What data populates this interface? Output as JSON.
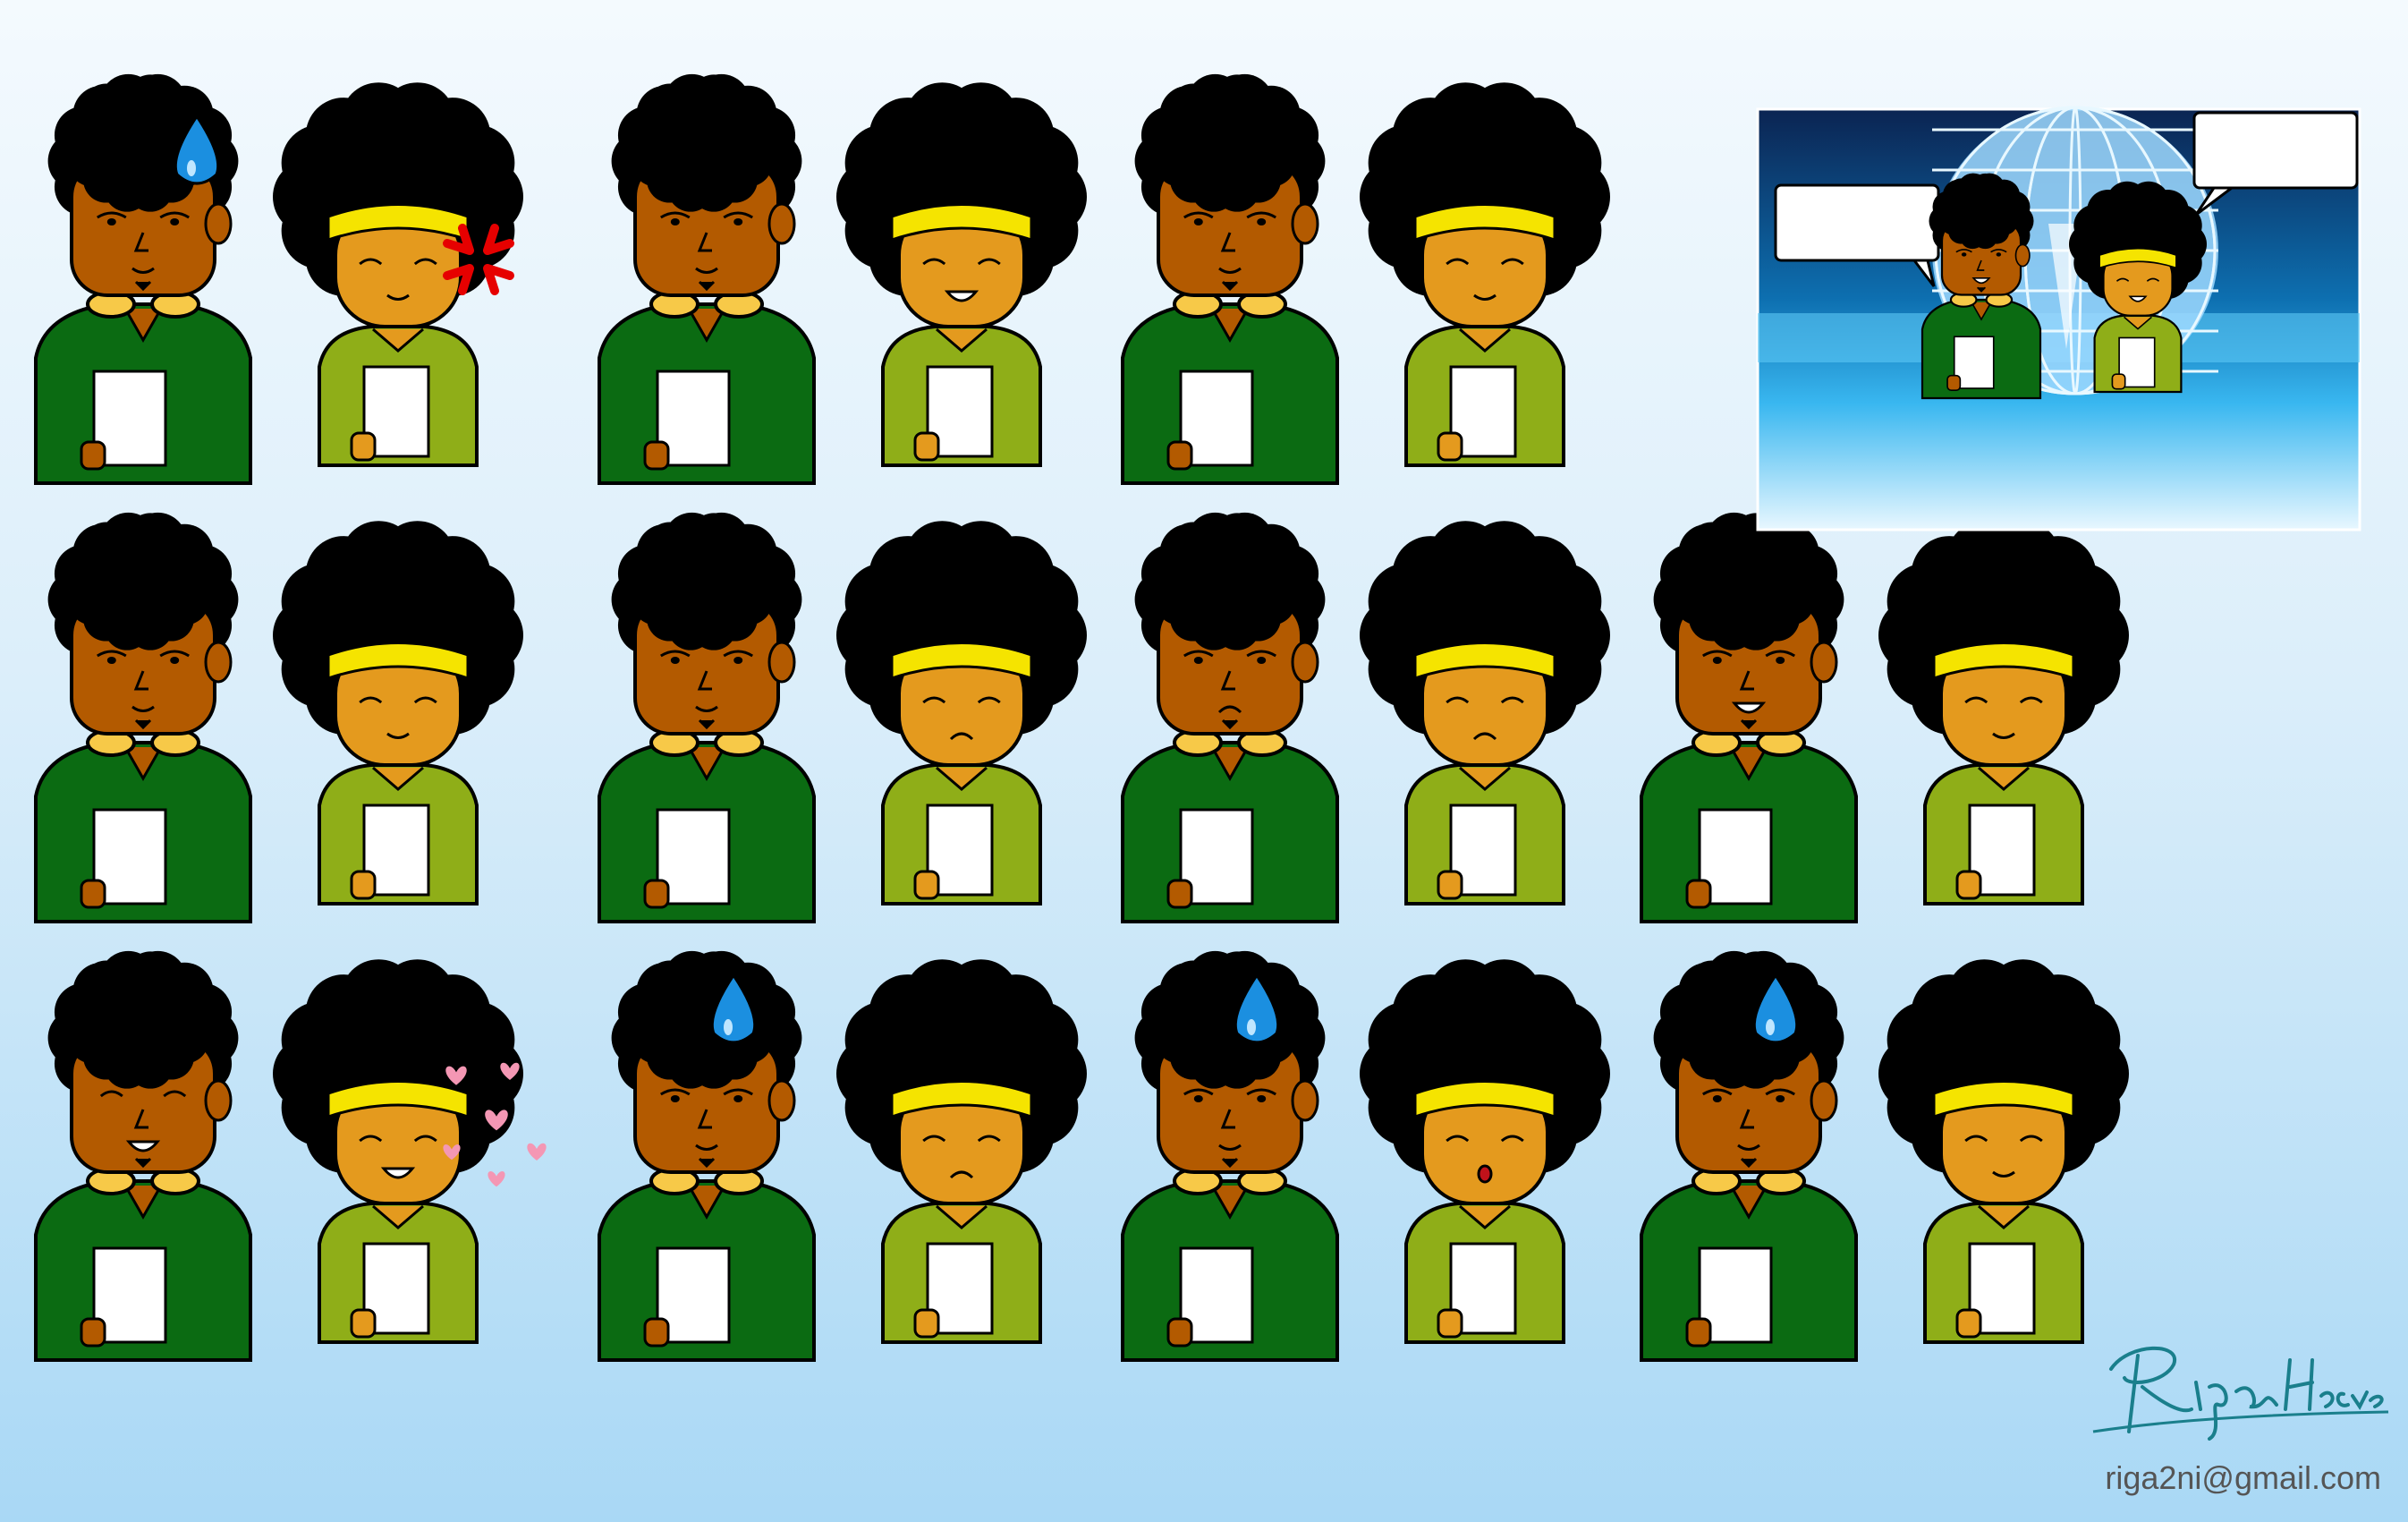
{
  "colors": {
    "skin_man": "#b35a00",
    "skin_girl": "#e49a1e",
    "shirt_man": "#0b6b12",
    "shirt_girl": "#8fae18",
    "hair": "#000000",
    "headband": "#f5e400",
    "goggles": "#f7c948",
    "paper": "#ffffff",
    "sweat": "#1b8fe0",
    "anger": "#e60000",
    "hearts": "#f497b4",
    "speech_bubble": "#ffffff",
    "signature": "#1a7f8c"
  },
  "sprite_rows": [
    [
      {
        "man_expression": "sweat-smirk",
        "girl_expression": "angry",
        "effect": "anger-mark"
      },
      {
        "man_expression": "neutral",
        "girl_expression": "grin",
        "effect": "none"
      },
      {
        "man_expression": "tired",
        "girl_expression": "worried-smile",
        "effect": "none"
      }
    ],
    [
      {
        "man_expression": "smirk",
        "girl_expression": "happy",
        "effect": "none"
      },
      {
        "man_expression": "bored",
        "girl_expression": "pout",
        "effect": "none"
      },
      {
        "man_expression": "frown",
        "girl_expression": "annoyed",
        "effect": "none"
      },
      {
        "man_expression": "talking",
        "girl_expression": "skeptical",
        "effect": "none"
      }
    ],
    [
      {
        "man_expression": "laugh",
        "girl_expression": "laugh",
        "effect": "hearts"
      },
      {
        "man_expression": "sweat-bored",
        "girl_expression": "sad",
        "effect": "sweat"
      },
      {
        "man_expression": "sweat-talk",
        "girl_expression": "gasp",
        "effect": "sweat"
      },
      {
        "man_expression": "sweat-neutral",
        "girl_expression": "reading",
        "effect": "sweat"
      }
    ]
  ],
  "preview": {
    "scene": "news-studio",
    "icons": [
      "globe-icon"
    ]
  },
  "signature_icon": "signature-icon",
  "email": "riga2ni@gmail.com"
}
